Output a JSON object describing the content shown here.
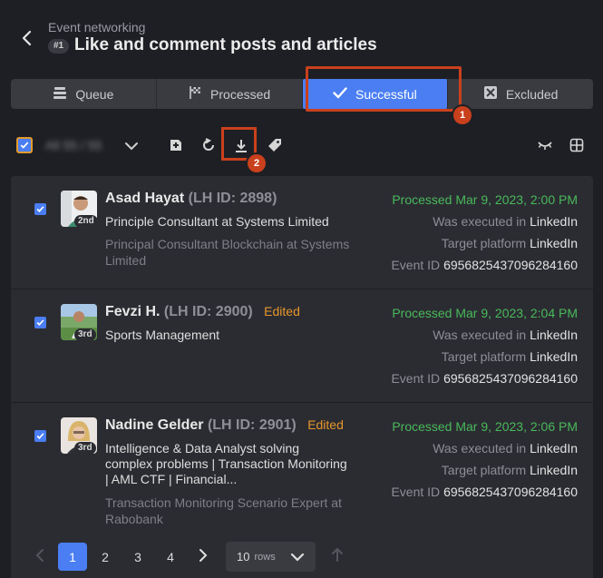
{
  "header": {
    "breadcrumb": "Event networking",
    "badge": "#1",
    "title": "Like and comment posts and articles"
  },
  "tabs": [
    {
      "label": "Queue",
      "icon": "queue-icon"
    },
    {
      "label": "Processed",
      "icon": "flag-icon"
    },
    {
      "label": "Successful",
      "icon": "check-icon",
      "active": true
    },
    {
      "label": "Excluded",
      "icon": "excluded-icon"
    }
  ],
  "markers": {
    "first": "1",
    "second": "2"
  },
  "toolbar": {
    "selected_count": "All 55 / 55",
    "tools": [
      "add-icon",
      "refresh-icon",
      "download-icon",
      "tag-icon"
    ],
    "right_tools": [
      "hide-icon",
      "grid-icon"
    ]
  },
  "rows": [
    {
      "name": "Asad Hayat",
      "lh_id": "(LH ID: 2898)",
      "edited": "",
      "degree": "2nd",
      "headline": "Principle Consultant at Systems Limited",
      "sub": "Principal Consultant Blockchain at Systems Limited",
      "status": "Processed Mar 9, 2023, 2:00 PM",
      "executed_label": "Was executed in",
      "executed_value": "LinkedIn",
      "platform_label": "Target platform",
      "platform_value": "LinkedIn",
      "event_label": "Event ID",
      "event_value": "6956825437096284160"
    },
    {
      "name": "Fevzi H.",
      "lh_id": "(LH ID: 2900)",
      "edited": "Edited",
      "degree": "3rd",
      "headline": "Sports Management",
      "sub": "",
      "status": "Processed Mar 9, 2023, 2:04 PM",
      "executed_label": "Was executed in",
      "executed_value": "LinkedIn",
      "platform_label": "Target platform",
      "platform_value": "LinkedIn",
      "event_label": "Event ID",
      "event_value": "6956825437096284160"
    },
    {
      "name": "Nadine Gelder",
      "lh_id": "(LH ID: 2901)",
      "edited": "Edited",
      "degree": "3rd",
      "headline": "Intelligence & Data Analyst solving complex problems | Transaction Monitoring | AML CTF | Financial...",
      "sub": "Transaction Monitoring Scenario Expert at Rabobank",
      "status": "Processed Mar 9, 2023, 2:06 PM",
      "executed_label": "Was executed in",
      "executed_value": "LinkedIn",
      "platform_label": "Target platform",
      "platform_value": "LinkedIn",
      "event_label": "Event ID",
      "event_value": "6956825437096284160"
    }
  ],
  "pagination": {
    "pages": [
      "1",
      "2",
      "3",
      "4"
    ],
    "current": "1",
    "rows_label": "10",
    "rows_suffix": "rows"
  },
  "colors": {
    "accent": "#4a7ef2",
    "highlight": "#c9401d",
    "success": "#49b95a",
    "edited": "#e6962b"
  }
}
